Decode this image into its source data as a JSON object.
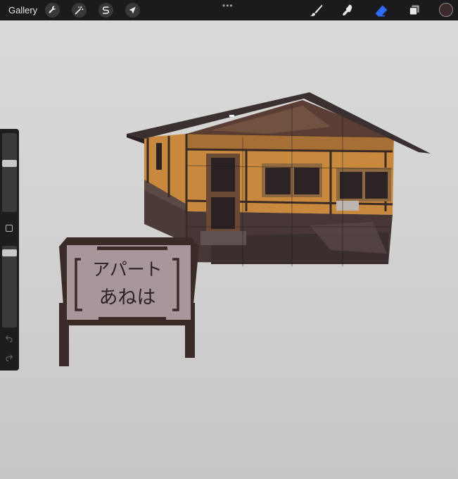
{
  "topbar": {
    "gallery_label": "Gallery",
    "left_tools": [
      "wrench-icon",
      "magic-wand-icon",
      "selection-s-icon",
      "transform-arrow-icon"
    ],
    "more_label": "•••",
    "right_tools": [
      "brush-icon",
      "smudge-icon",
      "eraser-icon",
      "layers-icon"
    ],
    "active_tool": "eraser-icon",
    "accent_color": "#2f6bff",
    "current_color": "#3b2a2c"
  },
  "sidebar": {
    "brush_size_level": 0.63,
    "opacity_level": 0.95,
    "undo_icon": "undo-icon",
    "redo_icon": "redo-icon"
  },
  "artwork": {
    "sign_line1": "アパート",
    "sign_line2": "あねは"
  }
}
